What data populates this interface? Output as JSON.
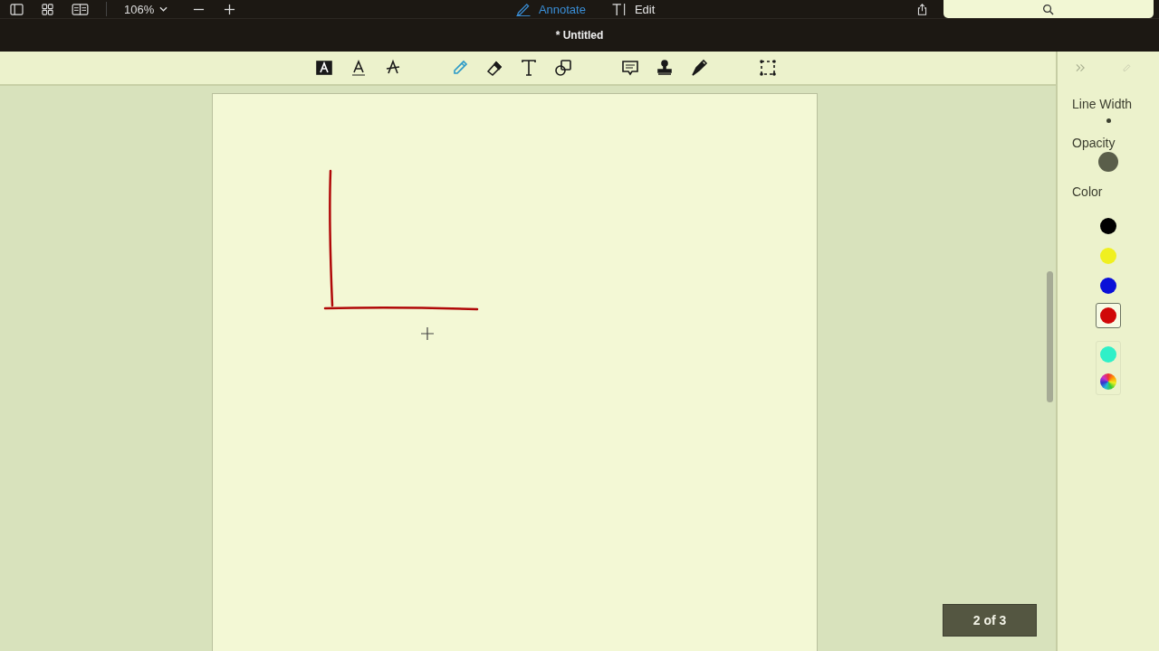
{
  "top_bar": {
    "zoom": "106%",
    "modes": [
      {
        "kind": "annotate",
        "label": "Annotate",
        "selected": true
      },
      {
        "kind": "edit",
        "label": "Edit",
        "selected": false
      }
    ]
  },
  "window": {
    "title": "* Untitled"
  },
  "tools": [
    {
      "kind": "highlight",
      "selected": false
    },
    {
      "kind": "underline",
      "selected": false
    },
    {
      "kind": "strike",
      "selected": false
    },
    {
      "kind": "pencil",
      "selected": true
    },
    {
      "kind": "eraser",
      "selected": false
    },
    {
      "kind": "text",
      "selected": false
    },
    {
      "kind": "shapes",
      "selected": false
    },
    {
      "kind": "note",
      "selected": false
    },
    {
      "kind": "stamp",
      "selected": false
    },
    {
      "kind": "pen",
      "selected": false
    },
    {
      "kind": "select",
      "selected": false
    }
  ],
  "sidebar": {
    "line_width_label": "Line Width",
    "opacity_label": "Opacity",
    "color_label": "Color",
    "colors": [
      {
        "color": "#000000",
        "selected": false
      },
      {
        "color": "#f0f020",
        "selected": false
      },
      {
        "color": "#0a10d8",
        "selected": false
      },
      {
        "color": "#d00808",
        "selected": true
      }
    ],
    "custom_colors": [
      {
        "kind": "swatch",
        "color": "#30f0c8"
      },
      {
        "kind": "wheel"
      }
    ]
  },
  "page_indicator": "2 of 3"
}
